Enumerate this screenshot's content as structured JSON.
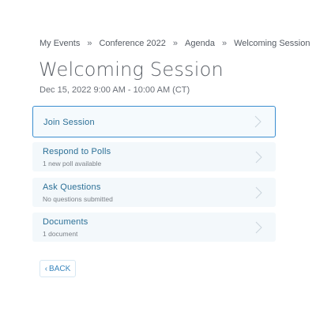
{
  "breadcrumb": {
    "items": [
      "My Events",
      "Conference 2022",
      "Agenda",
      "Welcoming Session"
    ],
    "separator": "»"
  },
  "page": {
    "title": "Welcoming Session",
    "datetime": "Dec 15, 2022 9:00 AM - 10:00 AM (CT)"
  },
  "actions": [
    {
      "label": "Join Session",
      "sub": ""
    },
    {
      "label": "Respond to Polls",
      "sub": "1 new poll available"
    },
    {
      "label": "Ask Questions",
      "sub": "No questions submitted"
    },
    {
      "label": "Documents",
      "sub": "1 document"
    }
  ],
  "back": {
    "caret": "‹",
    "label": "BACK"
  },
  "colors": {
    "accent": "#3b8ed0",
    "card_bg": "#f3f8fb",
    "link_text": "#2b6f96"
  },
  "icons": {
    "card_chevron": "chevron-right-icon",
    "back_caret": "chevron-left-icon"
  }
}
